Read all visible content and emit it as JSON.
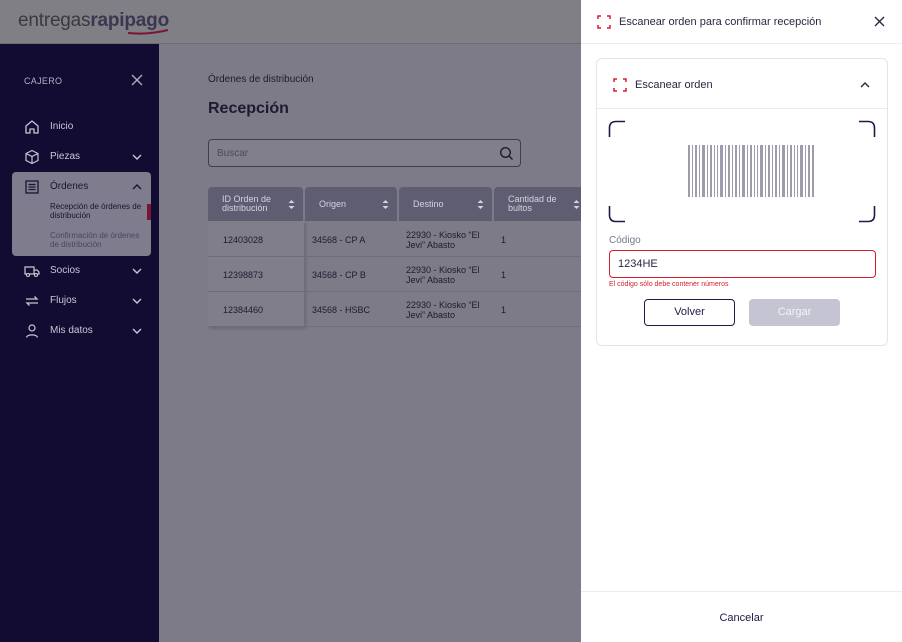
{
  "header": {
    "logo_part1": "entregas",
    "logo_part2": "rapipago"
  },
  "sidebar": {
    "role": "CAJERO",
    "items": [
      {
        "label": "Inicio",
        "icon": "home-icon"
      },
      {
        "label": "Piezas",
        "icon": "box-icon"
      },
      {
        "label": "Órdenes",
        "icon": "list-icon"
      },
      {
        "label": "Socios",
        "icon": "truck-icon"
      },
      {
        "label": "Flujos",
        "icon": "arrows-icon"
      },
      {
        "label": "Mis datos",
        "icon": "user-icon"
      }
    ],
    "subitems": [
      {
        "label": "Recepción de órdenes de distribución"
      },
      {
        "label": "Confirmación de órdenes de distribución"
      }
    ]
  },
  "main": {
    "breadcrumb": "Órdenes de distribución",
    "title": "Recepción",
    "search_placeholder": "Buscar",
    "table": {
      "columns": [
        "ID Orden de distribución",
        "Origen",
        "Destino",
        "Cantidad de bultos"
      ],
      "rows": [
        [
          "12403028",
          "34568 - CP A",
          "22930 - Kiosko “El Jevi” Abasto",
          "1"
        ],
        [
          "12398873",
          "34568 - CP B",
          "22930 - Kiosko “El Jevi” Abasto",
          "1"
        ],
        [
          "12384460",
          "34568 - HSBC",
          "22930 - Kiosko “El Jevi” Abasto",
          "1"
        ]
      ]
    }
  },
  "panel": {
    "title": "Escanear orden para confirmar recepción",
    "section_title": "Escanear orden",
    "code_label": "Código",
    "code_value": "1234HE",
    "error": "El código sólo debe contener números",
    "back_label": "Volver",
    "load_label": "Cargar",
    "cancel_label": "Cancelar"
  },
  "colors": {
    "accent": "#d4202e",
    "navy": "#1e1a47",
    "sidebar_bg": "#120b32"
  }
}
